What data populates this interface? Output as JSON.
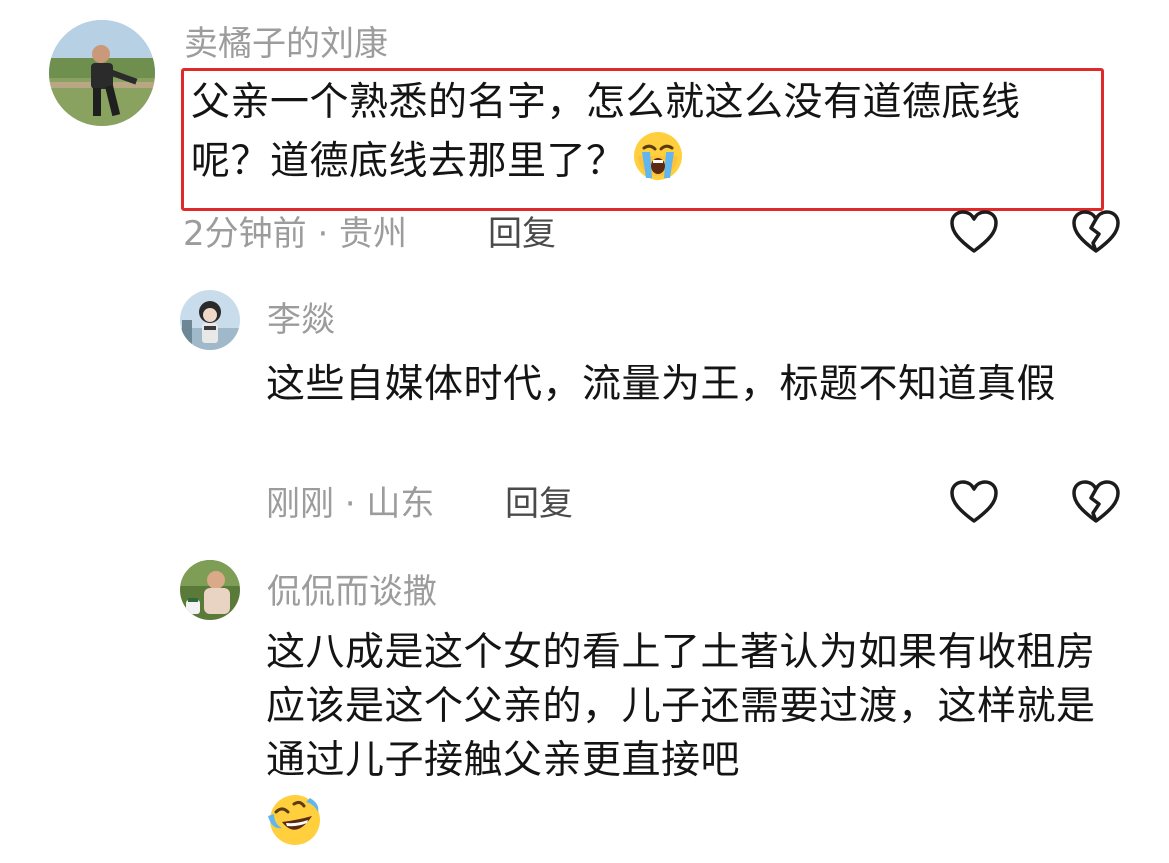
{
  "comments": [
    {
      "username": "卖橘子的刘康",
      "text": "父亲一个熟悉的名字，怎么就这么没有道德底线呢？道德底线去那里了？",
      "emoji": "crying-face",
      "time": "2分钟前",
      "location": "贵州",
      "meta": "2分钟前 · 贵州",
      "reply_label": "回复",
      "highlighted": true,
      "highlight_color": "#e02a2a"
    },
    {
      "username": "李燚",
      "text": "这些自媒体时代，流量为王，标题不知道真假",
      "time": "刚刚",
      "location": "山东",
      "meta": "刚刚 · 山东",
      "reply_label": "回复"
    },
    {
      "username": "侃侃而谈撒",
      "text": "这八成是这个女的看上了土著认为如果有收租房应该是这个父亲的，儿子还需要过渡，这样就是通过儿子接触父亲更直接吧",
      "emoji": "laughing-tears-face"
    }
  ],
  "icons": {
    "like": "heart-outline-icon",
    "dislike": "broken-heart-icon"
  },
  "colors": {
    "username": "#9c9c9c",
    "meta": "#9c9c9c",
    "text": "#141414",
    "highlight": "#e02a2a"
  }
}
